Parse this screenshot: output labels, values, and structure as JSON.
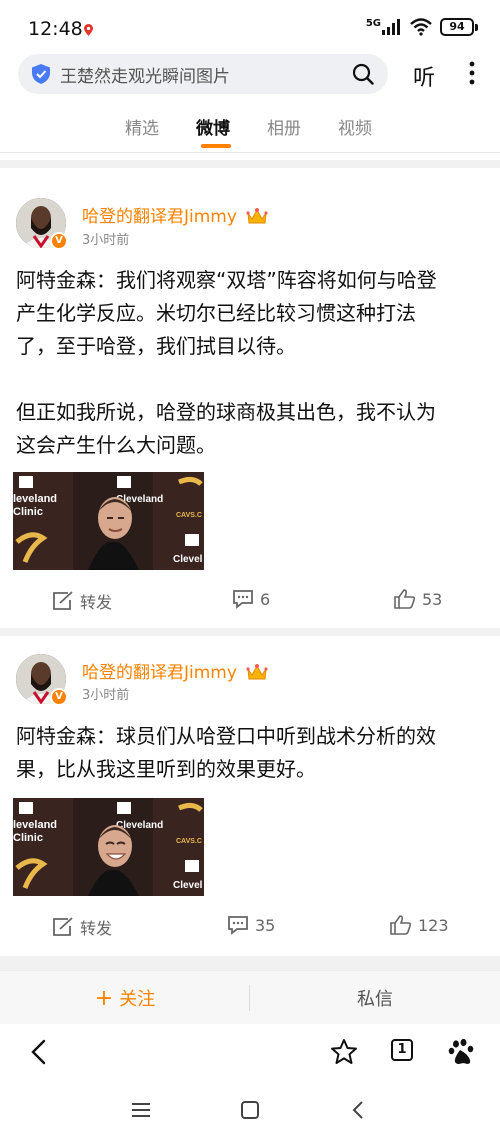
{
  "status_bar": {
    "time": "12:48",
    "network": "5G",
    "battery": "94"
  },
  "search": {
    "query": "王楚然走观光瞬间图片",
    "listen_label": "听"
  },
  "tabs": [
    {
      "label": "精选",
      "active": false
    },
    {
      "label": "微博",
      "active": true
    },
    {
      "label": "相册",
      "active": false
    },
    {
      "label": "视频",
      "active": false
    }
  ],
  "posts": [
    {
      "author": "哈登的翻译君Jimmy",
      "time": "3小时前",
      "text_lines": [
        "阿特金森：我们将观察“双塔”阵容将如何与哈登",
        "产生化学反应。米切尔已经比较习惯这种打法",
        "了，至于哈登，我们拭目以待。",
        "",
        "但正如我所说，哈登的球商极其出色，我不认为",
        "这会产生什么大问题。"
      ],
      "repost_label": "转发",
      "comments": "6",
      "likes": "53"
    },
    {
      "author": "哈登的翻译君Jimmy",
      "time": "3小时前",
      "text_lines": [
        "阿特金森：球员们从哈登口中听到战术分析的效",
        "果，比从我这里听到的效果更好。"
      ],
      "repost_label": "转发",
      "comments": "35",
      "likes": "123"
    }
  ],
  "bottom_bar": {
    "follow_label": "关注",
    "follow_plus": "+",
    "message_label": "私信"
  },
  "browser": {
    "tab_count": "1"
  },
  "image_text": {
    "left_brand": "leveland",
    "left_brand2": "Clinic",
    "mid_brand": "Cleveland",
    "cavs": "CAVS.C",
    "bottom": "Clevel"
  },
  "colors": {
    "accent": "#ff8200",
    "text": "#111111",
    "muted": "#8a8a8a",
    "divider": "#f1f1f1"
  }
}
